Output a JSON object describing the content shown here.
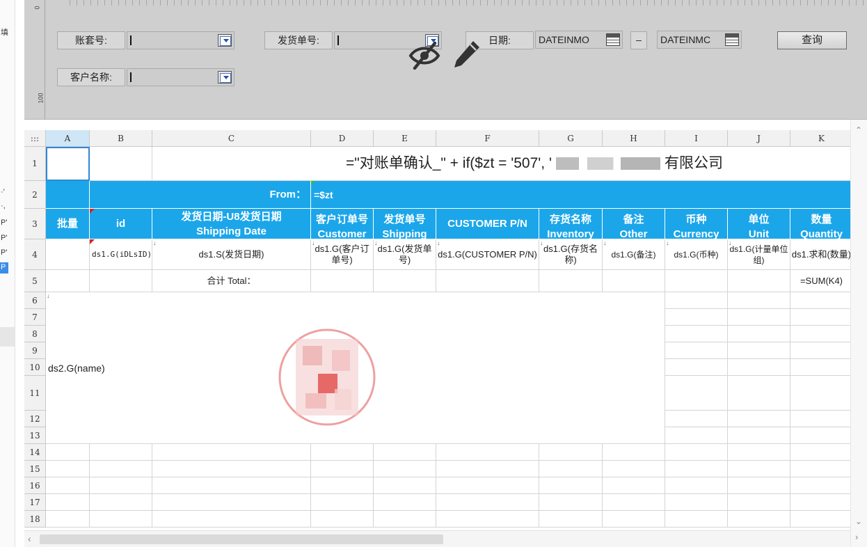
{
  "left_panel": {
    "fragments": [
      "填",
      "·'",
      "·,",
      "P'",
      "P'",
      "P'",
      "P"
    ]
  },
  "params": {
    "ruler_top": "0",
    "ruler_bottom": "100",
    "account_label": "账套号:",
    "shipment_label": "发货单号:",
    "date_label": "日期:",
    "customer_label": "客户名称:",
    "date_from": "DATEINMO",
    "date_to": "DATEINMC",
    "range_dash": "–",
    "query_label": "查询"
  },
  "grid": {
    "corner": ":::",
    "columns": [
      "A",
      "B",
      "C",
      "D",
      "E",
      "F",
      "G",
      "H",
      "I",
      "J",
      "K"
    ],
    "rows": [
      "1",
      "2",
      "3",
      "4",
      "5",
      "6",
      "7",
      "8",
      "9",
      "10",
      "11",
      "12",
      "13",
      "14",
      "15",
      "16",
      "17",
      "18"
    ],
    "title_formula": "=\"对账单确认_\" + if($zt = '507', '",
    "title_tail": "有限公司",
    "from_label": "From：",
    "from_value": "=$zt",
    "headers": {
      "a": "批量",
      "b": "id",
      "c1": "发货日期-U8发货日期",
      "c2": "Shipping Date",
      "d1": "客户订单号",
      "d2": "Customer",
      "e1": "发货单号",
      "e2": "Shipping",
      "f": "CUSTOMER P/N",
      "g1": "存货名称",
      "g2": "Inventory",
      "h1": "备注",
      "h2": "Other",
      "i1": "币种",
      "i2": "Currency",
      "j1": "单位",
      "j2": "Unit",
      "k1": "数量",
      "k2": "Quantity"
    },
    "row4": {
      "b": "ds1.G(iDLsID)",
      "c": "ds1.S(发货日期)",
      "d": "ds1.G(客户订单号)",
      "e": "ds1.G(发货单号)",
      "f": "ds1.G(CUSTOMER P/N)",
      "g": "ds1.G(存货名称)",
      "h": "ds1.G(备注)",
      "i": "ds1.G(币种)",
      "j": "ds1.G(计量单位组)",
      "k": "ds1.求和(数量)"
    },
    "row5": {
      "total": "合计 Total：",
      "sum": "=SUM(K4)"
    },
    "merged_a6": "ds2.G(name)"
  },
  "colors": {
    "header_blue": "#1ba6ea",
    "selection": "#2f87d8",
    "panel_gray": "#cfcfcf"
  }
}
